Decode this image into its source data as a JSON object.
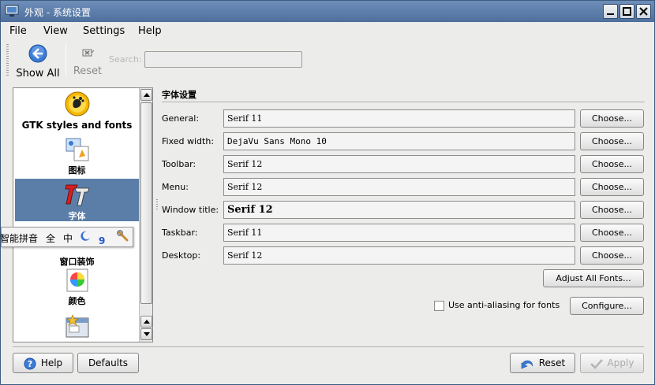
{
  "window": {
    "title": "外观 - 系统设置"
  },
  "menubar": {
    "items": [
      {
        "label": "File"
      },
      {
        "label": "View"
      },
      {
        "label": "Settings"
      },
      {
        "label": "Help"
      }
    ]
  },
  "toolbar": {
    "show_all_label": "Show All",
    "reset_label": "Reset",
    "search_label": "Search:",
    "search_value": ""
  },
  "sidebar": {
    "items": [
      {
        "label": "GTK styles and fonts",
        "icon": "gnome-foot-icon"
      },
      {
        "label": "图标",
        "icon": "icons-icon"
      },
      {
        "label": "字体",
        "icon": "fonts-icon",
        "selected": true
      },
      {
        "label": "窗口装饰",
        "icon": "window-decorations-icon"
      },
      {
        "label": "颜色",
        "icon": "colors-icon"
      },
      {
        "label": "",
        "icon": "style-icon"
      }
    ]
  },
  "ime": {
    "name": "智能拼音",
    "full": "全",
    "chinese": "中",
    "punct": "9"
  },
  "fonts": {
    "section_title": "字体设置",
    "rows": [
      {
        "label": "General:",
        "value": "Serif 11"
      },
      {
        "label": "Fixed width:",
        "value": "DejaVu Sans Mono 10"
      },
      {
        "label": "Toolbar:",
        "value": "Serif 12"
      },
      {
        "label": "Menu:",
        "value": "Serif 12"
      },
      {
        "label": "Window title:",
        "value": "Serif 12"
      },
      {
        "label": "Taskbar:",
        "value": "Serif 11"
      },
      {
        "label": "Desktop:",
        "value": "Serif 12"
      }
    ],
    "choose_label": "Choose...",
    "adjust_all_label": "Adjust All Fonts...",
    "antialias_label": "Use anti-aliasing for fonts",
    "antialias_checked": false,
    "configure_label": "Configure..."
  },
  "bottom": {
    "help_label": "Help",
    "defaults_label": "Defaults",
    "reset_label": "Reset",
    "apply_label": "Apply"
  },
  "colors": {
    "titlebar": "#5b7ea8",
    "selection": "#5b7ea8",
    "window_bg": "#ececea"
  }
}
